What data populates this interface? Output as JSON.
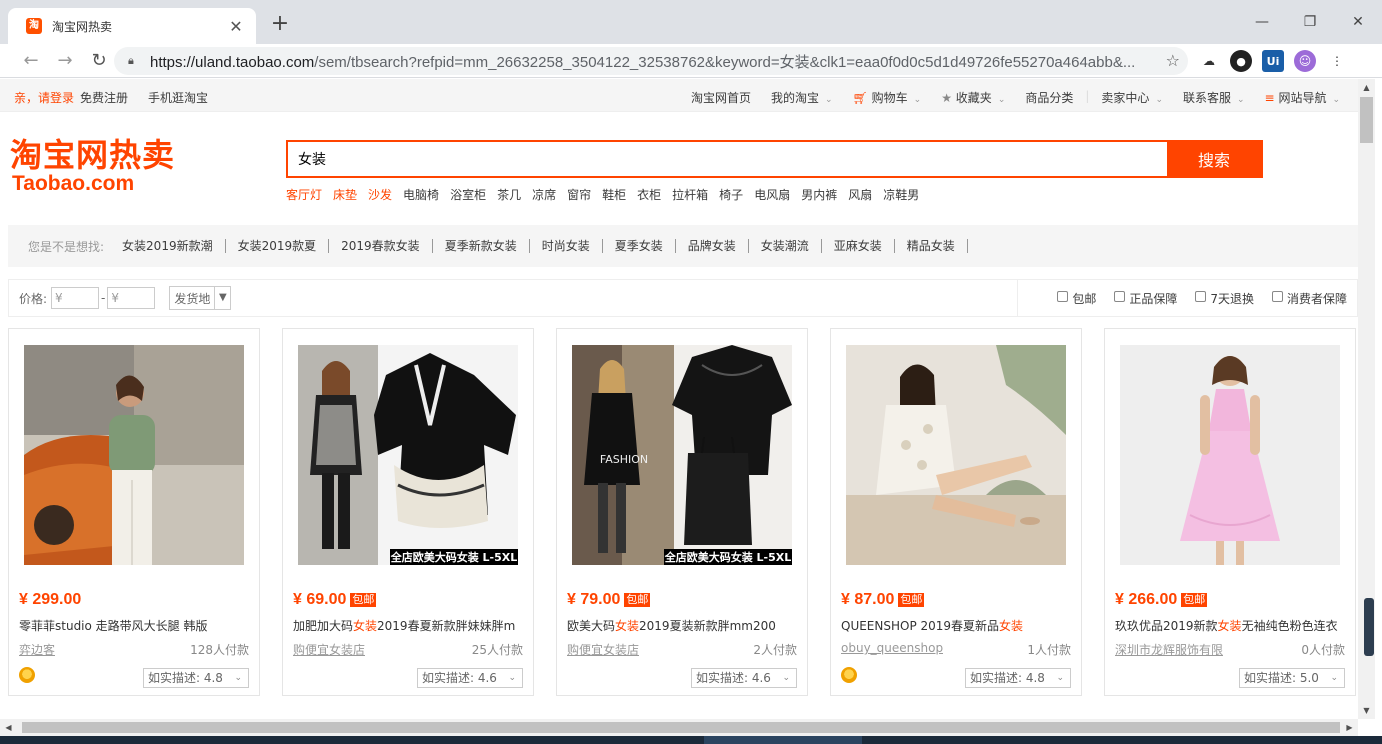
{
  "browser": {
    "tab_title": "淘宝网热卖",
    "favicon_text": "淘",
    "url_host": "https://uland.taobao.com",
    "url_path": "/sem/tbsearch?refpid=mm_26632258_3504122_32538762&keyword=女装&clk1=eaa0f0d0c5d1d49726fe55270a464abb&..."
  },
  "sitenav": {
    "login": "亲，请登录",
    "register": "免费注册",
    "mobile": "手机逛淘宝",
    "links": [
      "淘宝网首页",
      "我的淘宝",
      "购物车",
      "收藏夹",
      "商品分类",
      "卖家中心",
      "联系客服",
      "网站导航"
    ]
  },
  "logo": {
    "cn": "淘宝网热卖",
    "en": "Taobao.com"
  },
  "search": {
    "value": "女装",
    "button": "搜索"
  },
  "hotwords": [
    "客厅灯",
    "床垫",
    "沙发",
    "电脑椅",
    "浴室柜",
    "茶几",
    "凉席",
    "窗帘",
    "鞋柜",
    "衣柜",
    "拉杆箱",
    "椅子",
    "电风扇",
    "男内裤",
    "风扇",
    "凉鞋男"
  ],
  "suggest": {
    "label": "您是不是想找:",
    "items": [
      "女装2019新款潮",
      "女装2019款夏",
      "2019春款女装",
      "夏季新款女装",
      "时尚女装",
      "夏季女装",
      "品牌女装",
      "女装潮流",
      "亚麻女装",
      "精品女装"
    ]
  },
  "filter": {
    "price_label": "价格:",
    "price_min": "¥",
    "price_max": "¥",
    "ship_from": "发货地",
    "checks": [
      "包邮",
      "正品保障",
      "7天退换",
      "消费者保障"
    ]
  },
  "products": [
    {
      "price": "¥ 299.00",
      "badge": "",
      "title_pre": "零菲菲studio 走路带风大长腿 韩版",
      "keyword": "",
      "title_post": "",
      "shop": "弈边客",
      "sold": "128人付款",
      "desc": "如实描述: 4.8",
      "medal": true
    },
    {
      "price": "¥ 69.00",
      "badge": "包邮",
      "title_pre": "加肥加大码",
      "keyword": "女装",
      "title_post": "2019春夏新款胖妹妹胖m",
      "shop": "购便宜女装店",
      "sold": "25人付款",
      "desc": "如实描述: 4.6",
      "medal": false
    },
    {
      "price": "¥ 79.00",
      "badge": "包邮",
      "title_pre": "欧美大码",
      "keyword": "女装",
      "title_post": "2019夏装新款胖mm200",
      "shop": "购便宜女装店",
      "sold": "2人付款",
      "desc": "如实描述: 4.6",
      "medal": false
    },
    {
      "price": "¥ 87.00",
      "badge": "包邮",
      "title_pre": "QUEENSHOP 2019春夏新品",
      "keyword": "女装",
      "title_post": "",
      "shop": "obuy_queenshop",
      "sold": "1人付款",
      "desc": "如实描述: 4.8",
      "medal": true
    },
    {
      "price": "¥ 266.00",
      "badge": "包邮",
      "title_pre": "玖玖优品2019新款",
      "keyword": "女装",
      "title_post": "无袖纯色粉色连衣",
      "shop": "深圳市龙辉服饰有限",
      "sold": "0人付款",
      "desc": "如实描述: 5.0",
      "medal": false
    }
  ],
  "image_captions": {
    "p2": "全店欧美大码女装 L-5XL",
    "p3": "全店欧美大码女装 L-5XL",
    "p3_sign": "FASHION"
  },
  "colors": {
    "brand": "#ff4400",
    "text": "#3c3c3c",
    "muted": "#999999"
  }
}
